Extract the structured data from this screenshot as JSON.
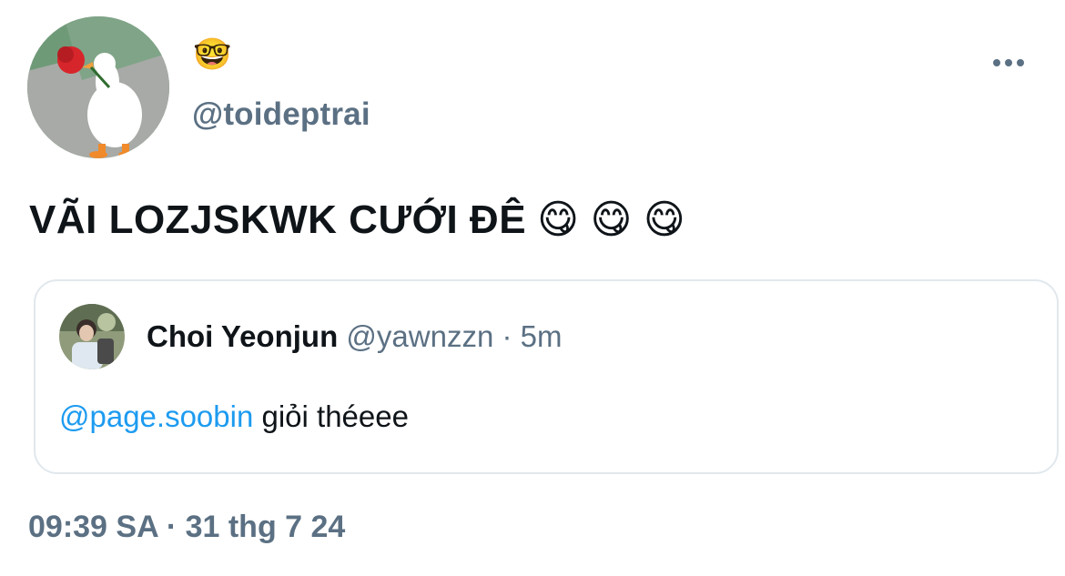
{
  "author": {
    "display_name": "🤓",
    "handle": "@toideptrai"
  },
  "more_icon": "ellipsis-horizontal-icon",
  "tweet": {
    "text": "VÃI LOZJSKWK CƯỚI ĐÊ",
    "emojis": [
      "😋",
      "😋",
      "😋"
    ]
  },
  "quoted_tweet": {
    "name": "Choi Yeonjun",
    "handle": "@yawnzzn",
    "separator": " · ",
    "time": "5m",
    "mention": "@page.soobin",
    "text": " giỏi théeee"
  },
  "timestamp": {
    "time": "09:39 SA",
    "separator": " · ",
    "date": "31 thg 7 24"
  },
  "colors": {
    "secondary_text": "#5b7083",
    "link": "#1d9bf0",
    "border": "#e1e8ed",
    "primary_text": "#0f1419"
  }
}
